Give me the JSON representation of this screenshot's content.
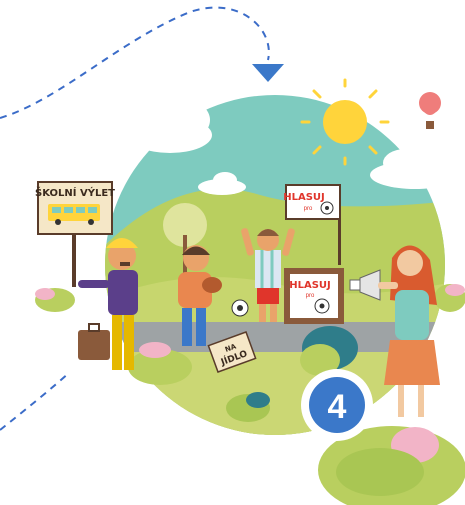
{
  "illustration": {
    "school_trip_sign": "ŠKOLNÍ VÝLET",
    "vote_banner_top": "HLASUJ",
    "vote_banner_top_sub": "pro",
    "vote_banner_stand": "HLASUJ",
    "vote_banner_stand_sub": "pro",
    "ground_sign_line1": "NA",
    "ground_sign_line2": "JÍDLO",
    "step_number": "4"
  },
  "colors": {
    "sky": "#7ecbbf",
    "hills": "#a9c653",
    "road": "#9ea3a5",
    "sun": "#ffd43b",
    "dashed_line": "#3b6cc8",
    "badge": "#3b78c9",
    "vote_red": "#e0352b"
  }
}
